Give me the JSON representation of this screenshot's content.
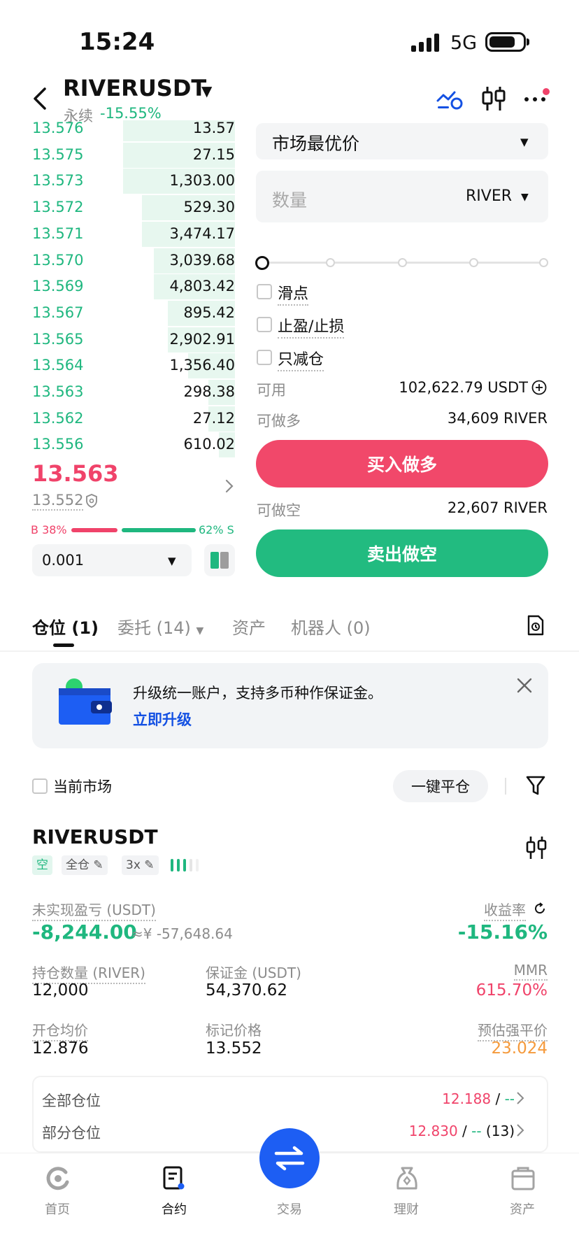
{
  "status_bar": {
    "time": "15:24",
    "network": "5G"
  },
  "header": {
    "symbol": "RIVERUSDT",
    "contract_type": "永续",
    "change": "-15.55%",
    "icons": [
      "back-icon",
      "caret-down-icon",
      "analysis-icon",
      "candlestick-icon",
      "more-icon"
    ],
    "notification_dot_color": "#f0436a"
  },
  "order_book": {
    "rows": [
      {
        "price": "13.576",
        "qty": "13.57",
        "depth": 0.55
      },
      {
        "price": "13.575",
        "qty": "27.15",
        "depth": 0.55
      },
      {
        "price": "13.573",
        "qty": "1,303.00",
        "depth": 0.55
      },
      {
        "price": "13.572",
        "qty": "529.30",
        "depth": 0.46
      },
      {
        "price": "13.571",
        "qty": "3,474.17",
        "depth": 0.46
      },
      {
        "price": "13.570",
        "qty": "3,039.68",
        "depth": 0.4
      },
      {
        "price": "13.569",
        "qty": "4,803.42",
        "depth": 0.4
      },
      {
        "price": "13.567",
        "qty": "895.42",
        "depth": 0.33
      },
      {
        "price": "13.565",
        "qty": "2,902.91",
        "depth": 0.33
      },
      {
        "price": "13.564",
        "qty": "1,356.40",
        "depth": 0.23
      },
      {
        "price": "13.563",
        "qty": "298.38",
        "depth": 0.13
      },
      {
        "price": "13.562",
        "qty": "27.12",
        "depth": 0.13
      },
      {
        "price": "13.556",
        "qty": "610.02",
        "depth": 0.08
      }
    ],
    "last_price": "13.563",
    "mark_price": "13.552",
    "buy_ratio_label": "B 38%",
    "sell_ratio_label": "62% S",
    "buy_ratio": 0.38,
    "tick_size": "0.001"
  },
  "order_form": {
    "order_type": "市场最优价",
    "qty_placeholder": "数量",
    "qty_unit": "RIVER",
    "options": [
      "滑点",
      "止盈/止损",
      "只减仓"
    ],
    "available_label": "可用",
    "available_value": "102,622.79 USDT",
    "can_long_label": "可做多",
    "can_long_value": "34,609 RIVER",
    "buy_button": "买入做多",
    "can_short_label": "可做空",
    "can_short_value": "22,607 RIVER",
    "sell_button": "卖出做空",
    "buy_color": "#f1486a",
    "sell_color": "#22bb80"
  },
  "tabs": {
    "positions": "仓位",
    "positions_count": "(1)",
    "orders": "委托",
    "orders_count": "(14)",
    "assets": "资产",
    "bots": "机器人",
    "bots_count": "(0)"
  },
  "banner": {
    "text": "升级统一账户，支持多币种作保证金。",
    "link": "立即升级"
  },
  "filter": {
    "current_market": "当前市场",
    "close_all": "一键平仓"
  },
  "position": {
    "symbol": "RIVERUSDT",
    "side": "空",
    "margin_mode": "全仓",
    "leverage": "3x",
    "pnl_label": "未实现盈亏 (USDT)",
    "pnl_value": "-8,244.00",
    "pnl_cny": "≈¥ -57,648.64",
    "roe_label": "收益率",
    "roe_value": "-15.16%",
    "size_label": "持仓数量 (RIVER)",
    "size_value": "12,000",
    "margin_label": "保证金 (USDT)",
    "margin_value": "54,370.62",
    "mmr_label": "MMR",
    "mmr_value": "615.70%",
    "entry_label": "开仓均价",
    "entry_value": "12.876",
    "markp_label": "标记价格",
    "markp_value": "13.552",
    "liq_label": "预估强平价",
    "liq_value": "23.024",
    "tpsl": [
      {
        "label": "全部仓位",
        "price": "12.188",
        "sep": " / ",
        "other": "--",
        "count": ""
      },
      {
        "label": "部分仓位",
        "price": "12.830",
        "sep": " / ",
        "other": "--",
        "count": " (13)"
      }
    ]
  },
  "bottom_nav": {
    "home": "首页",
    "futures": "合约",
    "trade": "交易",
    "earn": "理财",
    "assets": "资产"
  }
}
